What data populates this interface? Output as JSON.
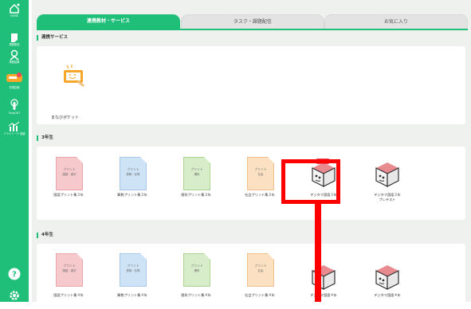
{
  "sidebar": {
    "items": [
      {
        "label": "HOME",
        "icon": "home-icon"
      },
      {
        "label": "課題配信",
        "icon": "assignment-icon"
      },
      {
        "label": "課題結果",
        "icon": "results-icon"
      },
      {
        "label": "まなびポケット",
        "icon": "manabi-logo"
      },
      {
        "label": "学習記録",
        "icon": "record-icon"
      },
      {
        "label": "Sing!287",
        "icon": "touch-icon"
      },
      {
        "label": "ミライシード 成績",
        "icon": "chart-icon"
      }
    ],
    "help_icon": "question-icon",
    "settings_icon": "gear-icon"
  },
  "tabs": [
    {
      "label": "連携教材・サービス",
      "active": true
    },
    {
      "label": "タスク・課題配信",
      "active": false
    },
    {
      "label": "お気に入り",
      "active": false
    }
  ],
  "sections": {
    "services": {
      "title": "連携サービス",
      "items": [
        {
          "label": "まなびポケット"
        }
      ]
    },
    "grade3": {
      "title": "3年生",
      "items": [
        {
          "t1": "プリント",
          "t2": "国語・漢字",
          "caption": "国語プリント集３年",
          "color": "#f6c9cc",
          "border": "#e8a6ab"
        },
        {
          "t1": "プリント",
          "t2": "算数・計算",
          "caption": "算数プリント集３年",
          "color": "#cfe3f6",
          "border": "#a8c8e8"
        },
        {
          "t1": "プリント",
          "t2": "理科",
          "caption": "理科プリント集３年",
          "color": "#d7ecc9",
          "border": "#a9d38f"
        },
        {
          "t1": "プリント",
          "t2": "社会",
          "caption": "社会プリント集３年",
          "color": "#fbe0c2",
          "border": "#efc08d"
        },
        {
          "caption": "デジタマ国語３年",
          "badge": "国語",
          "type": "digitama"
        },
        {
          "caption": "デジタマ国語３年",
          "caption2": "プレテスト",
          "type": "digitama-plain"
        }
      ]
    },
    "grade4": {
      "title": "4年生",
      "items": [
        {
          "t1": "プリント",
          "t2": "国語・漢字",
          "caption": "国語プリント集４年",
          "color": "#f6c9cc",
          "border": "#e8a6ab"
        },
        {
          "t1": "プリント",
          "t2": "算数・計算",
          "caption": "算数プリント集４年",
          "color": "#cfe3f6",
          "border": "#a8c8e8"
        },
        {
          "t1": "プリント",
          "t2": "理科",
          "caption": "理科プリント集４年",
          "color": "#d7ecc9",
          "border": "#a9d38f"
        },
        {
          "t1": "プリント",
          "t2": "社会",
          "caption": "社会プリント集４年",
          "color": "#fbe0c2",
          "border": "#efc08d"
        },
        {
          "caption": "デジタマ国語４年",
          "type": "digitama"
        },
        {
          "caption": "デジタマ国語４年",
          "type": "digitama"
        }
      ]
    }
  },
  "colors": {
    "accent": "#1fbf7a",
    "highlight": "#ff0000"
  }
}
